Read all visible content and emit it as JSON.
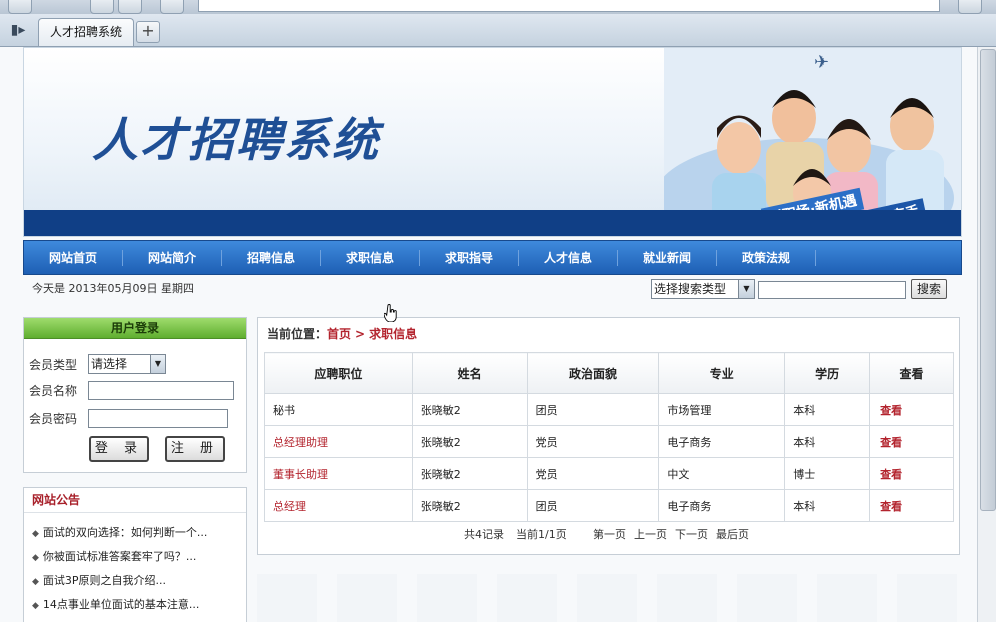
{
  "browser": {
    "tab_title": "人才招聘系统",
    "new_tab_symbol": "+"
  },
  "banner": {
    "title": "人才招聘系统",
    "slogan_1": "新职场·新机遇",
    "slogan_2": "造就职场高手"
  },
  "nav": {
    "items": [
      "网站首页",
      "网站简介",
      "招聘信息",
      "求职信息",
      "求职指导",
      "人才信息",
      "就业新闻",
      "政策法规"
    ]
  },
  "topbar": {
    "date_text": "今天是 2013年05月09日 星期四",
    "search_type_selected": "选择搜索类型",
    "search_button": "搜索"
  },
  "login": {
    "title": "用户登录",
    "type_label": "会员类型",
    "type_selected": "请选择",
    "name_label": "会员名称",
    "password_label": "会员密码",
    "login_button": "登 录",
    "register_button": "注 册"
  },
  "notice": {
    "title": "网站公告",
    "items": [
      "面试的双向选择：如何判断一个...",
      "你被面试标准答案套牢了吗？...",
      "面试3P原则之自我介绍...",
      "14点事业单位面试的基本注意..."
    ]
  },
  "main": {
    "breadcrumb_label": "当前位置：",
    "breadcrumb_home": "首页",
    "breadcrumb_sep": ">",
    "breadcrumb_current": "求职信息",
    "columns": [
      "应聘职位",
      "姓名",
      "政治面貌",
      "专业",
      "学历",
      "查看"
    ],
    "rows": [
      [
        "秘书",
        "张晓敏2",
        "团员",
        "市场管理",
        "本科",
        "查看"
      ],
      [
        "总经理助理",
        "张晓敏2",
        "党员",
        "电子商务",
        "本科",
        "查看"
      ],
      [
        "董事长助理",
        "张晓敏2",
        "党员",
        "中文",
        "博士",
        "查看"
      ],
      [
        "总经理",
        "张晓敏2",
        "团员",
        "电子商务",
        "本科",
        "查看"
      ]
    ],
    "pager": {
      "total": "共4记录",
      "current": "当前1/1页",
      "first": "第一页",
      "prev": "上一页",
      "next": "下一页",
      "last": "最后页"
    }
  },
  "colors": {
    "nav_blue": "#1e5fb4",
    "banner_blue": "#103f86",
    "accent_red": "#b3242e",
    "login_green": "#5fae2f"
  }
}
